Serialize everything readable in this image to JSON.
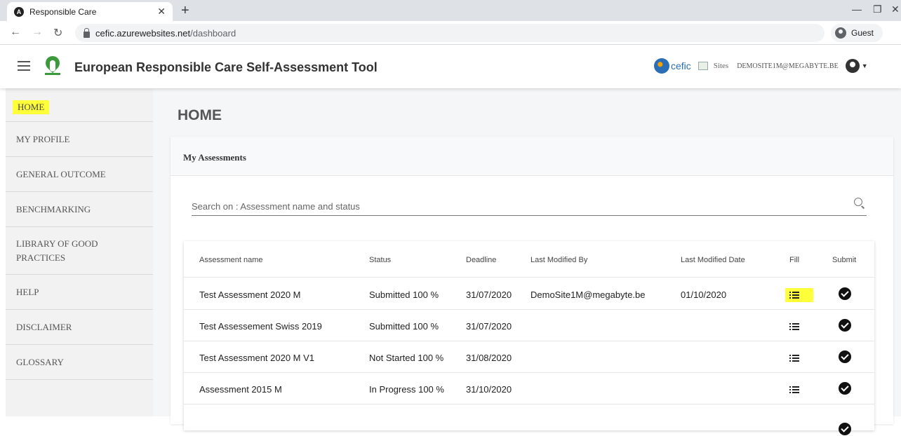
{
  "browser": {
    "tab_title": "Responsible Care",
    "url_host": "cefic.azurewebsites.net",
    "url_path": "/dashboard",
    "profile_label": "Guest"
  },
  "header": {
    "app_title": "European Responsible Care Self-Assessment Tool",
    "cefic_label": "cefic",
    "sites_label": "Sites",
    "user_email": "DEMOSITE1M@MEGABYTE.BE"
  },
  "sidebar": {
    "items": [
      {
        "label": "HOME",
        "active": true
      },
      {
        "label": "MY PROFILE"
      },
      {
        "label": "GENERAL OUTCOME"
      },
      {
        "label": "BENCHMARKING"
      },
      {
        "label": "LIBRARY OF GOOD PRACTICES"
      },
      {
        "label": "HELP"
      },
      {
        "label": "DISCLAIMER"
      },
      {
        "label": "GLOSSARY"
      }
    ]
  },
  "main": {
    "page_title": "HOME",
    "card_title": "My Assessments",
    "search_placeholder": "Search on : Assessment name and status"
  },
  "table": {
    "headers": {
      "name": "Assessment name",
      "status": "Status",
      "deadline": "Deadline",
      "modified_by": "Last Modified By",
      "modified_date": "Last Modified Date",
      "fill": "Fill",
      "submit": "Submit"
    },
    "rows": [
      {
        "name": "Test Assessment 2020 M",
        "status": "Submitted 100 %",
        "deadline": "31/07/2020",
        "modified_by": "DemoSite1M@megabyte.be",
        "modified_date": "01/10/2020"
      },
      {
        "name": "Test Assessement Swiss 2019",
        "status": "Submitted 100 %",
        "deadline": "31/07/2020",
        "modified_by": "",
        "modified_date": ""
      },
      {
        "name": "Test Assessment 2020 M V1",
        "status": "Not Started 100 %",
        "deadline": "31/08/2020",
        "modified_by": "",
        "modified_date": ""
      },
      {
        "name": "Assessment 2015 M",
        "status": "In Progress 100 %",
        "deadline": "31/10/2020",
        "modified_by": "",
        "modified_date": ""
      }
    ]
  },
  "colors": {
    "highlight": "#ffff3a",
    "sidebar_bg": "#f2f2f2",
    "cefic_blue": "#2a6fb5"
  }
}
